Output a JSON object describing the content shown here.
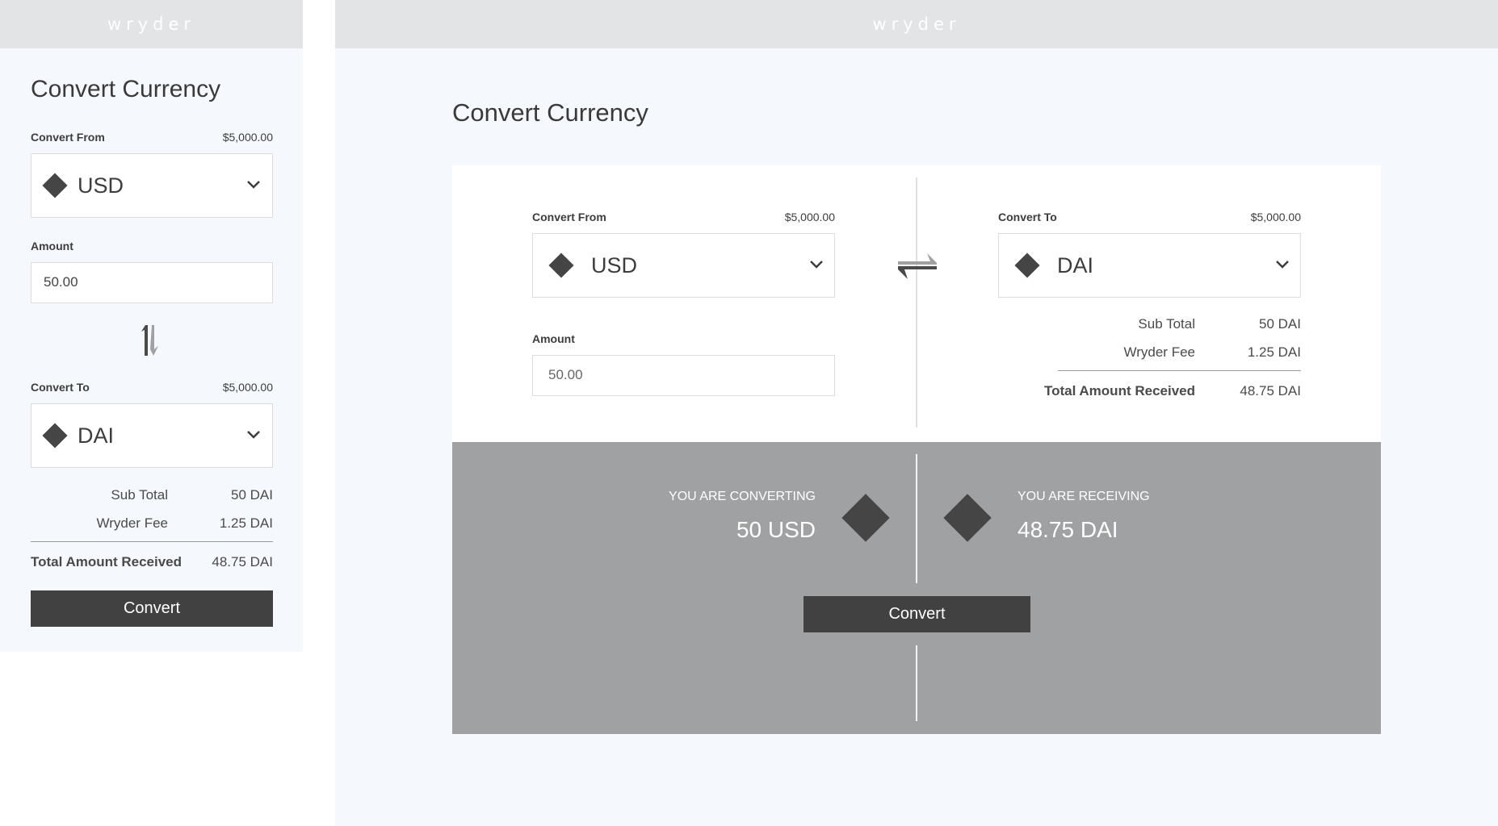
{
  "brand": {
    "logo_text": "wryder"
  },
  "mobile": {
    "title": "Convert Currency",
    "from": {
      "label": "Convert From",
      "balance": "$5,000.00",
      "currency": "USD",
      "icon": "diamond-icon"
    },
    "amount": {
      "label": "Amount",
      "value": "50.00"
    },
    "swap_icon": "swap-vertical-icon",
    "to": {
      "label": "Convert To",
      "balance": "$5,000.00",
      "currency": "DAI",
      "icon": "diamond-icon"
    },
    "summary": {
      "subtotal_label": "Sub Total",
      "subtotal_value": "50 DAI",
      "fee_label": "Wryder Fee",
      "fee_value": "1.25 DAI",
      "total_label": "Total Amount Received",
      "total_value": "48.75 DAI"
    },
    "convert_label": "Convert"
  },
  "desktop": {
    "title": "Convert Currency",
    "from": {
      "label": "Convert From",
      "balance": "$5,000.00",
      "currency": "USD",
      "icon": "diamond-icon"
    },
    "amount": {
      "label": "Amount",
      "value": "50.00"
    },
    "swap_icon": "swap-horizontal-icon",
    "to": {
      "label": "Convert To",
      "balance": "$5,000.00",
      "currency": "DAI",
      "icon": "diamond-icon"
    },
    "summary": {
      "subtotal_label": "Sub Total",
      "subtotal_value": "50 DAI",
      "fee_label": "Wryder Fee",
      "fee_value": "1.25 DAI",
      "total_label": "Total Amount Received",
      "total_value": "48.75 DAI"
    },
    "converting": {
      "caption": "YOU ARE CONVERTING",
      "value": "50 USD"
    },
    "receiving": {
      "caption": "YOU ARE RECEIVING",
      "value": "48.75 DAI"
    },
    "convert_label": "Convert"
  },
  "colors": {
    "header_bg": "#e3e4e6",
    "panel_bg": "#f5f9fd",
    "band_bg": "#a0a1a3",
    "dark": "#414141"
  }
}
